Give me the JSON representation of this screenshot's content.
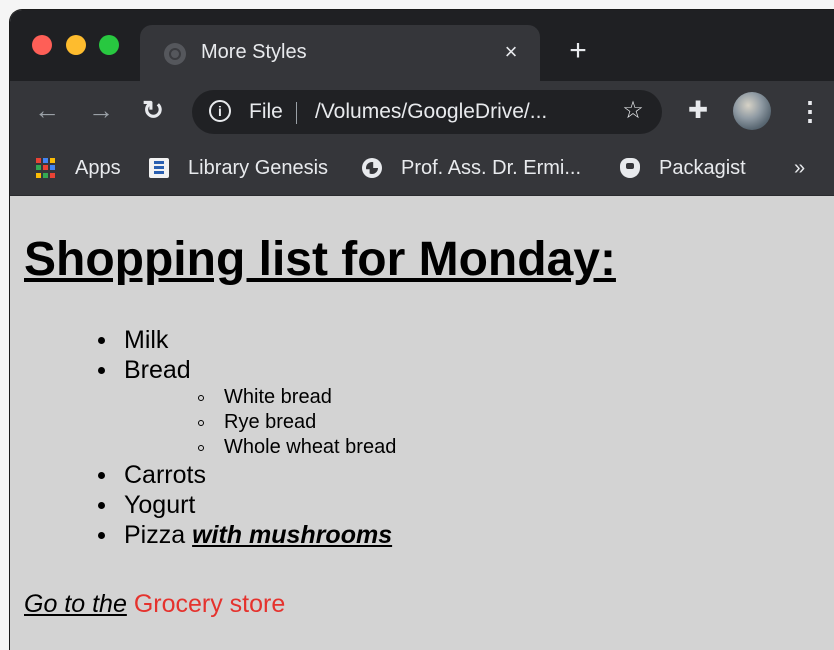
{
  "browser": {
    "tab": {
      "title": "More Styles",
      "close_glyph": "×"
    },
    "new_tab_glyph": "+",
    "address": {
      "scheme": "File",
      "url": "/Volumes/GoogleDrive/..."
    },
    "bookmarks": [
      {
        "label": "Apps",
        "icon": "apps-grid-icon"
      },
      {
        "label": "Library Genesis",
        "icon": "library-genesis-icon"
      },
      {
        "label": "Prof. Ass. Dr. Ermi...",
        "icon": "globe-icon"
      },
      {
        "label": "Packagist",
        "icon": "packagist-icon"
      }
    ],
    "bookmarks_more": "»"
  },
  "page": {
    "heading": "Shopping list for Monday:",
    "items": [
      {
        "text": "Milk"
      },
      {
        "text": "Bread",
        "sub": [
          "White bread",
          "Rye bread",
          "Whole wheat bread"
        ]
      },
      {
        "text": "Carrots"
      },
      {
        "text": "Yogurt"
      },
      {
        "text": "Pizza",
        "emphasis": "with mushrooms"
      }
    ],
    "footer": {
      "prefix": "Go to the",
      "link": "Grocery store"
    }
  },
  "colors": {
    "link": "#e5322d",
    "page_background": "#d3d3d3",
    "chrome_dark": "#35363a"
  }
}
